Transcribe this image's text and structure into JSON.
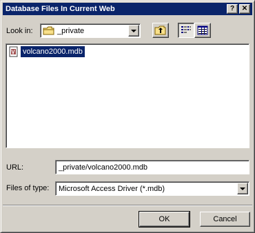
{
  "window": {
    "title": "Database Files In Current Web",
    "help_glyph": "?",
    "close_glyph": "✕"
  },
  "look_in": {
    "label": "Look in:",
    "value": "_private",
    "icon": "folder-icon"
  },
  "toolbar": {
    "up_folder_icon": "up-folder-icon",
    "list_view_icon": "list-view-icon",
    "details_view_icon": "details-view-icon"
  },
  "files": [
    {
      "name": "volcano2000.mdb",
      "icon": "database-file-icon",
      "selected": true
    }
  ],
  "url": {
    "label": "URL:",
    "value": "_private/volcano2000.mdb"
  },
  "file_type": {
    "label": "Files of type:",
    "value": "Microsoft Access Driver (*.mdb)"
  },
  "buttons": {
    "ok": "OK",
    "cancel": "Cancel"
  },
  "colors": {
    "titlebar": "#0a246a",
    "face": "#d4d0c8",
    "selection": "#0a246a"
  }
}
